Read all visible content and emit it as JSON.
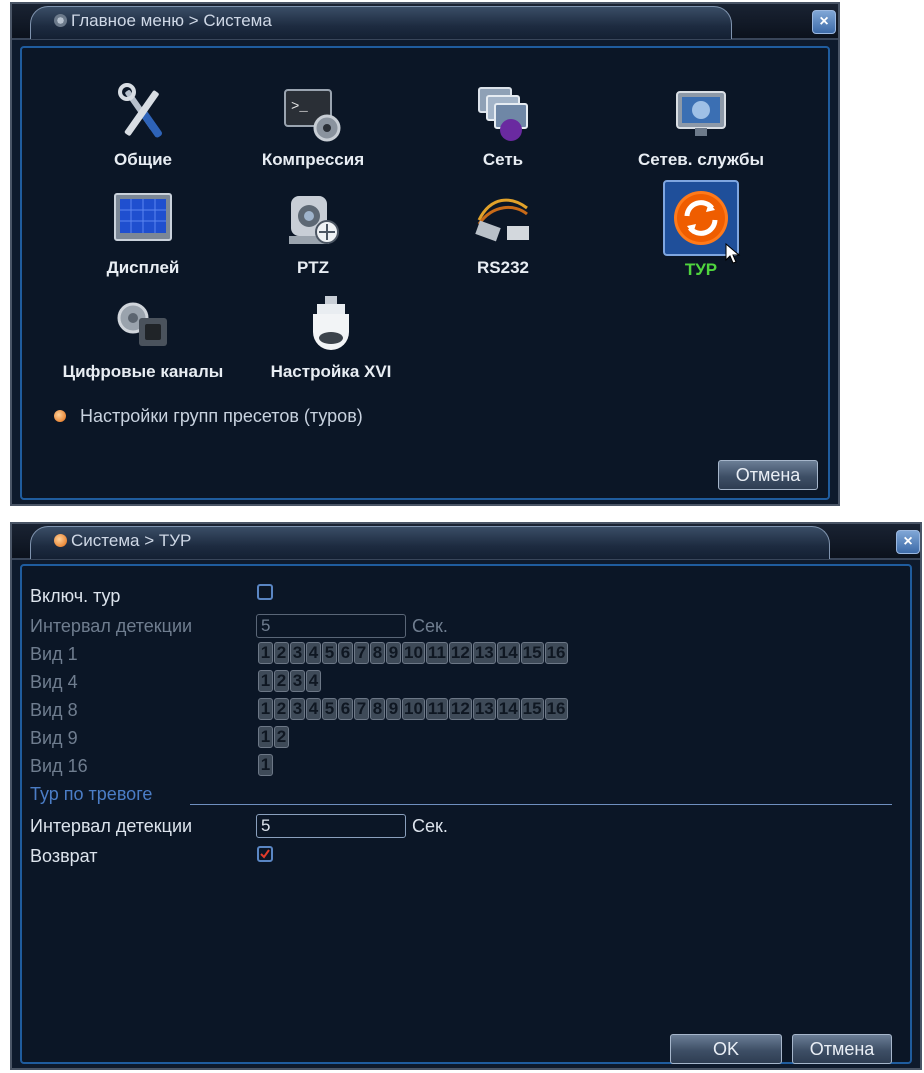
{
  "main_menu": {
    "title": "Главное меню > Система",
    "close_label": "×",
    "items": [
      {
        "label": "Общие",
        "icon": "tools-icon"
      },
      {
        "label": "Компрессия",
        "icon": "compression-icon"
      },
      {
        "label": "Сеть",
        "icon": "network-icon"
      },
      {
        "label": "Сетев. службы",
        "icon": "net-services-icon"
      },
      {
        "label": "Дисплей",
        "icon": "display-icon"
      },
      {
        "label": "PTZ",
        "icon": "ptz-icon"
      },
      {
        "label": "RS232",
        "icon": "rs232-icon"
      },
      {
        "label": "ТУР",
        "icon": "tour-icon"
      },
      {
        "label": "Цифровые каналы",
        "icon": "digital-channels-icon"
      },
      {
        "label": "Настройка XVI",
        "icon": "xvi-icon"
      }
    ],
    "hint": "Настройки групп пресетов (туров)",
    "cancel_label": "Отмена"
  },
  "tour_dialog": {
    "title": "Система > ТУР",
    "close_label": "×",
    "enable_label": "Включ. тур",
    "enable_checked": false,
    "interval_label": "Интервал детекции",
    "interval_value": "5",
    "interval_unit": "Сек.",
    "views": [
      {
        "label": "Вид 1",
        "numbers": [
          "1",
          "2",
          "3",
          "4",
          "5",
          "6",
          "7",
          "8",
          "9",
          "10",
          "11",
          "12",
          "13",
          "14",
          "15",
          "16"
        ]
      },
      {
        "label": "Вид 4",
        "numbers": [
          "1",
          "2",
          "3",
          "4"
        ]
      },
      {
        "label": "Вид 8",
        "numbers": [
          "1",
          "2",
          "3",
          "4",
          "5",
          "6",
          "7",
          "8",
          "9",
          "10",
          "11",
          "12",
          "13",
          "14",
          "15",
          "16"
        ]
      },
      {
        "label": "Вид 9",
        "numbers": [
          "1",
          "2"
        ]
      },
      {
        "label": "Вид 16",
        "numbers": [
          "1"
        ]
      }
    ],
    "alarm_section": "Тур по тревоге",
    "alarm_interval_label": "Интервал детекции",
    "alarm_interval_value": "5",
    "alarm_interval_unit": "Сек.",
    "return_label": "Возврат",
    "return_checked": true,
    "ok_label": "OK",
    "cancel_label": "Отмена"
  }
}
